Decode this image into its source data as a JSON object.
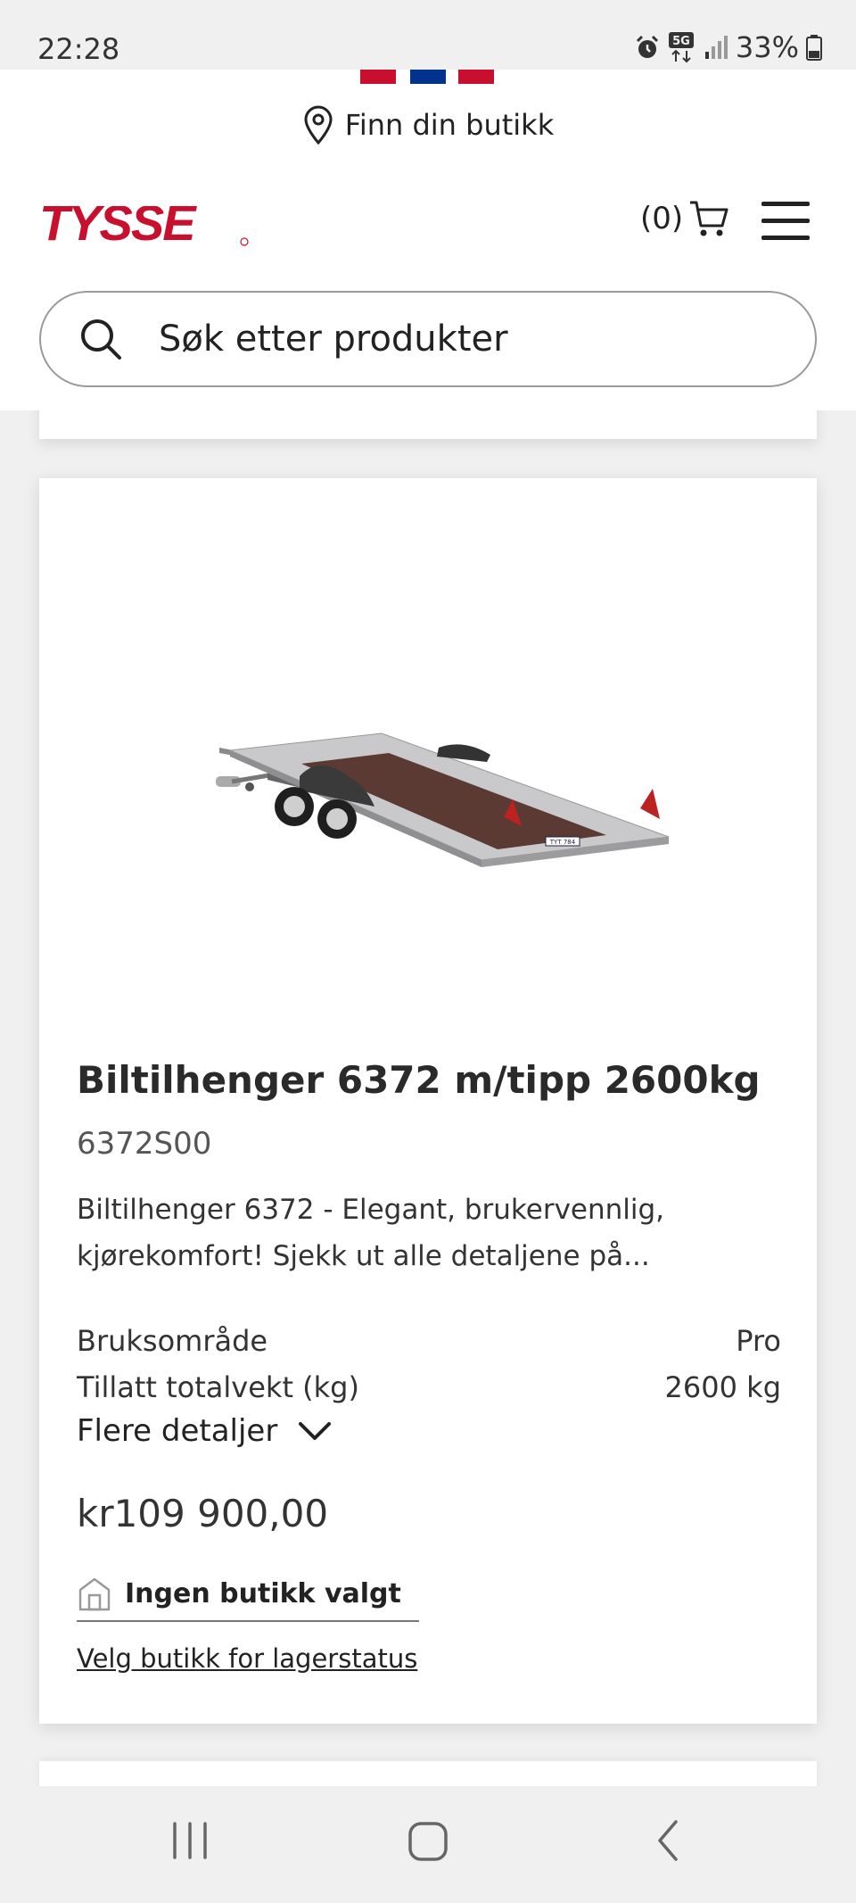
{
  "status_bar": {
    "time": "22:28",
    "battery": "33%",
    "network": "5G",
    "icons": [
      "alarm-icon",
      "5g-icon",
      "signal-icon",
      "battery-icon"
    ]
  },
  "header": {
    "flag_colors": [
      "#c8102e",
      "#00338d",
      "#c8102e"
    ],
    "store_finder": "Finn din butikk",
    "logo_text": "TYSSE",
    "brand_color": "#c8102e",
    "cart_count": "(0)",
    "search_placeholder": "Søk etter produkter"
  },
  "product": {
    "title": "Biltilhenger 6372 m/tipp 2600kg",
    "sku": "6372S00",
    "description": "Biltilhenger 6372 - Elegant, brukervennlig, kjørekomfort! Sjekk ut alle detaljene på...",
    "specs": [
      {
        "label": "Bruksområde",
        "value": "Pro"
      },
      {
        "label": "Tillatt totalvekt (kg)",
        "value": "2600 kg"
      }
    ],
    "more_details": "Flere detaljer",
    "price": "kr109 900,00",
    "store_status": "Ingen butikk valgt",
    "store_link": "Velg butikk for lagerstatus",
    "plate_text": "TYT 784"
  },
  "navbar": {
    "icons": [
      "recent-apps-icon",
      "home-icon",
      "back-icon"
    ]
  }
}
